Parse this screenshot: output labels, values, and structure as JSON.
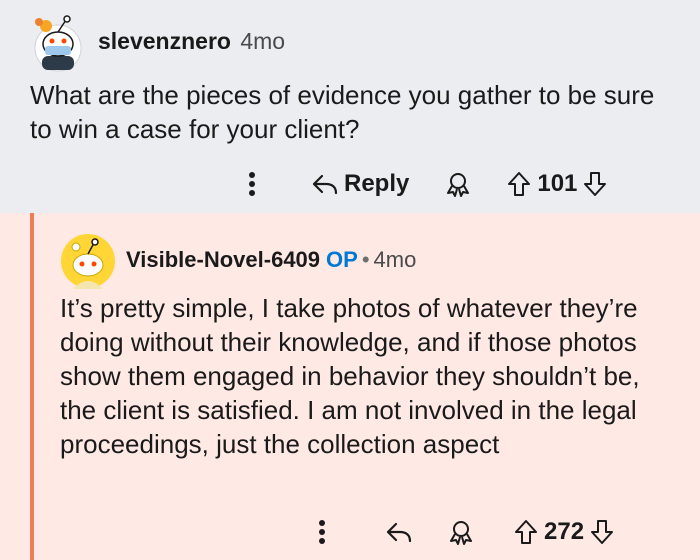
{
  "comment1": {
    "username": "slevenznero",
    "time": "4mo",
    "body": "What are the pieces of evidence you gather to be sure to win a case for your client?",
    "actions": {
      "reply_label": "Reply",
      "score": "101"
    }
  },
  "comment2": {
    "username": "Visible-Novel-6409",
    "op_badge": "OP",
    "separator": "•",
    "time": "4mo",
    "body": "It’s pretty simple, I take photos of whatever they’re doing without their knowledge, and if those photos show them engaged in behavior they shouldn’t be, the client is satisfied. I am not involved in the legal proceedings, just the collection aspect",
    "actions": {
      "score": "272"
    }
  },
  "colors": {
    "thread_rail": "#ef7d59",
    "op_badge": "#0079d3",
    "reply_bg": "#ffe9e5",
    "parent_bg": "#ebedf0"
  }
}
